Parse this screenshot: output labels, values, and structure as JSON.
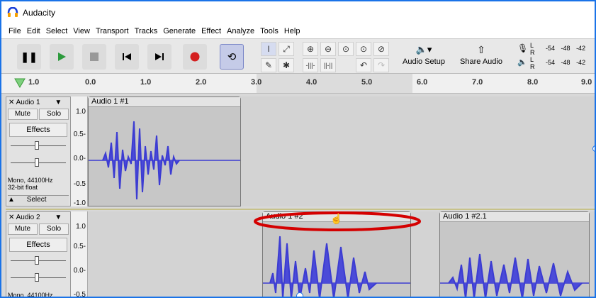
{
  "window": {
    "title": "Audacity"
  },
  "menu": [
    "File",
    "Edit",
    "Select",
    "View",
    "Transport",
    "Tracks",
    "Generate",
    "Effect",
    "Analyze",
    "Tools",
    "Help"
  ],
  "toolbar": {
    "audio_setup": "Audio Setup",
    "share_audio": "Share Audio",
    "meter_ticks": [
      "-54",
      "-48",
      "-42"
    ],
    "meter_l": "L",
    "meter_r": "R"
  },
  "ruler": {
    "ticks": [
      "1.0",
      "0.0",
      "1.0",
      "2.0",
      "3.0",
      "4.0",
      "5.0",
      "6.0",
      "7.0",
      "8.0",
      "9.0"
    ]
  },
  "tracks": [
    {
      "name": "Audio 1",
      "mute": "Mute",
      "solo": "Solo",
      "effects": "Effects",
      "info1": "Mono, 44100Hz",
      "info2": "32-bit float",
      "select": "Select",
      "scale": [
        "1.0",
        "0.5-",
        "0.0-",
        "-0.5",
        "-1.0"
      ],
      "clips": [
        {
          "label": "Audio 1 #1"
        }
      ]
    },
    {
      "name": "Audio 2",
      "mute": "Mute",
      "solo": "Solo",
      "effects": "Effects",
      "info1": "Mono, 44100Hz",
      "scale": [
        "1.0",
        "0.5-",
        "0.0-",
        "-0.5"
      ],
      "clips": [
        {
          "label": "Audio 1 #2"
        },
        {
          "label": "Audio 1 #2.1"
        }
      ]
    }
  ],
  "colors": {
    "waveform": "#3c3cd2",
    "highlight": "#d40000",
    "accent": "#1a73e8"
  }
}
